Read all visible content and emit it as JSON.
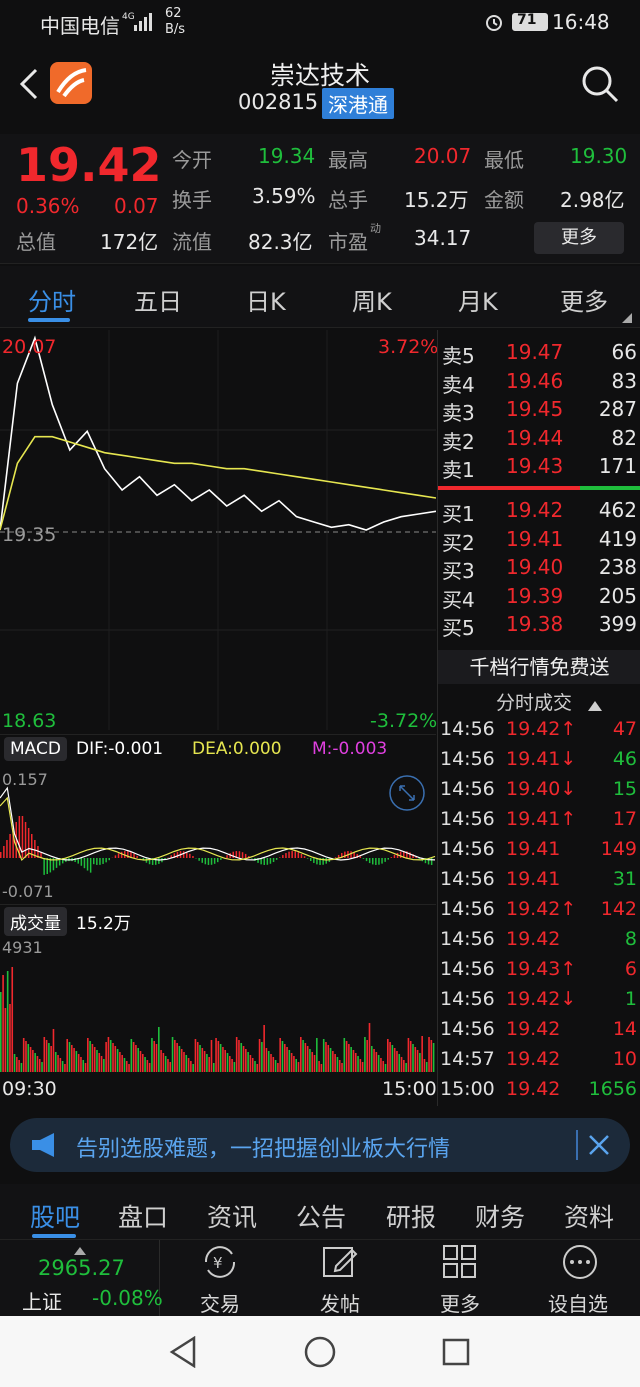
{
  "status": {
    "carrier": "中国电信",
    "net": "4G",
    "speed_value": "62",
    "speed_unit": "B/s",
    "battery": "71",
    "time": "16:48"
  },
  "header": {
    "title": "崇达技术",
    "code": "002815",
    "badge": "深港通"
  },
  "quote": {
    "price": "19.42",
    "change_pct": "0.36%",
    "change": "0.07",
    "open_label": "今开",
    "open": "19.34",
    "high_label": "最高",
    "high": "20.07",
    "low_label": "最低",
    "low": "19.30",
    "turnover_label": "换手",
    "turnover": "3.59%",
    "volume_label": "总手",
    "volume": "15.2万",
    "amount_label": "金额",
    "amount": "2.98亿",
    "mktcap_label": "总值",
    "mktcap": "172亿",
    "float_label": "流值",
    "float": "82.3亿",
    "pe_label": "市盈",
    "pe_sup": "动",
    "pe": "34.17",
    "more": "更多"
  },
  "tabs": [
    "分时",
    "五日",
    "日K",
    "周K",
    "月K",
    "更多"
  ],
  "chart": {
    "top_price": "20.07",
    "top_pct": "3.72%",
    "mid_price": "19.35",
    "bot_price": "18.63",
    "bot_pct": "-3.72%",
    "macd_label": "MACD",
    "dif": "DIF:-0.001",
    "dea": "DEA:0.000",
    "m": "M:-0.003",
    "macd_top": "0.157",
    "macd_bot": "-0.071",
    "vol_label": "成交量",
    "vol_value": "15.2万",
    "vol_top": "4931",
    "time_start": "09:30",
    "time_end": "15:00",
    "colors": {
      "price": "#ffffff",
      "avg": "#e6e650",
      "up": "#f0282d",
      "down": "#1fbe3c"
    }
  },
  "chart_data": {
    "type": "line",
    "title": "",
    "ylim": [
      18.63,
      20.07
    ],
    "x": [
      "09:30",
      "15:00"
    ],
    "series": [
      {
        "values": [
          19.35,
          19.9,
          20.07,
          19.82,
          19.65,
          19.72,
          19.58,
          19.5,
          19.55,
          19.48,
          19.52,
          19.46,
          19.5,
          19.44,
          19.48,
          19.42,
          19.46,
          19.4,
          19.38,
          19.36,
          19.37,
          19.35,
          19.38,
          19.4,
          19.41,
          19.42
        ]
      },
      {
        "values": [
          19.35,
          19.6,
          19.7,
          19.7,
          19.68,
          19.66,
          19.64,
          19.63,
          19.62,
          19.61,
          19.6,
          19.6,
          19.59,
          19.58,
          19.58,
          19.57,
          19.56,
          19.55,
          19.54,
          19.53,
          19.52,
          19.51,
          19.5,
          19.49,
          19.48,
          19.47
        ]
      }
    ]
  },
  "orderbook": {
    "asks": [
      {
        "label": "卖5",
        "price": "19.47",
        "vol": "66"
      },
      {
        "label": "卖4",
        "price": "19.46",
        "vol": "83"
      },
      {
        "label": "卖3",
        "price": "19.45",
        "vol": "287"
      },
      {
        "label": "卖2",
        "price": "19.44",
        "vol": "82"
      },
      {
        "label": "卖1",
        "price": "19.43",
        "vol": "171"
      }
    ],
    "bids": [
      {
        "label": "买1",
        "price": "19.42",
        "vol": "462"
      },
      {
        "label": "买2",
        "price": "19.41",
        "vol": "419"
      },
      {
        "label": "买3",
        "price": "19.40",
        "vol": "238"
      },
      {
        "label": "买4",
        "price": "19.39",
        "vol": "205"
      },
      {
        "label": "买5",
        "price": "19.38",
        "vol": "399"
      }
    ],
    "promo": "千档行情免费送",
    "ticks_title": "分时成交"
  },
  "ticks": [
    {
      "t": "14:56",
      "p": "19.42↑",
      "v": "47",
      "c": "red"
    },
    {
      "t": "14:56",
      "p": "19.41↓",
      "v": "46",
      "c": "green"
    },
    {
      "t": "14:56",
      "p": "19.40↓",
      "v": "15",
      "c": "green"
    },
    {
      "t": "14:56",
      "p": "19.41↑",
      "v": "17",
      "c": "red"
    },
    {
      "t": "14:56",
      "p": "19.41",
      "v": "149",
      "c": "red"
    },
    {
      "t": "14:56",
      "p": "19.41",
      "v": "31",
      "c": "green"
    },
    {
      "t": "14:56",
      "p": "19.42↑",
      "v": "142",
      "c": "red"
    },
    {
      "t": "14:56",
      "p": "19.42",
      "v": "8",
      "c": "green"
    },
    {
      "t": "14:56",
      "p": "19.43↑",
      "v": "6",
      "c": "red"
    },
    {
      "t": "14:56",
      "p": "19.42↓",
      "v": "1",
      "c": "green"
    },
    {
      "t": "14:56",
      "p": "19.42",
      "v": "14",
      "c": "red"
    },
    {
      "t": "14:57",
      "p": "19.42",
      "v": "10",
      "c": "red"
    },
    {
      "t": "15:00",
      "p": "19.42",
      "v": "1656",
      "c": "green"
    }
  ],
  "banner": {
    "text": "告别选股难题，一招把握创业板大行情"
  },
  "bottom_tabs": [
    "股吧",
    "盘口",
    "资讯",
    "公告",
    "研报",
    "财务",
    "资料"
  ],
  "toolbar": {
    "index_value": "2965.27",
    "index_name": "上证",
    "index_change": "-0.08%",
    "items": [
      "交易",
      "发帖",
      "更多",
      "设自选"
    ]
  }
}
